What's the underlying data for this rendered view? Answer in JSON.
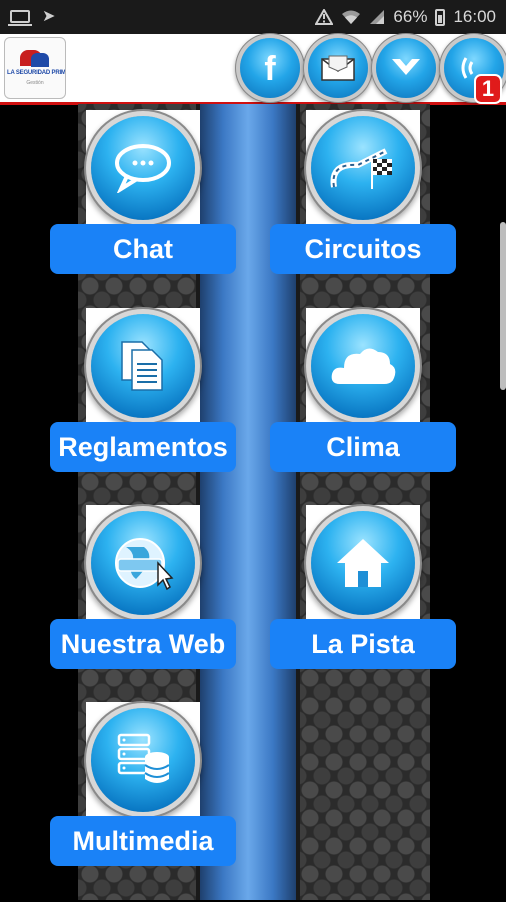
{
  "status_bar": {
    "battery": "66%",
    "time": "16:00",
    "icons": [
      "screen-icon",
      "send-icon",
      "alert-icon",
      "wifi-icon",
      "signal-icon",
      "battery-icon"
    ]
  },
  "header": {
    "logo_text": "LA SEGURIDAD PRIMERO",
    "logo_sub": "Gestión",
    "buttons": [
      "facebook-icon",
      "mail-icon",
      "heart-icon",
      "notification-icon"
    ],
    "notification_count": "1"
  },
  "menu": {
    "items": [
      {
        "label": "Chat",
        "icon": "chat-icon"
      },
      {
        "label": "Circuitos",
        "icon": "race-track-icon"
      },
      {
        "label": "Reglamentos",
        "icon": "documents-icon"
      },
      {
        "label": "Clima",
        "icon": "cloud-icon"
      },
      {
        "label": "Nuestra Web",
        "icon": "globe-icon"
      },
      {
        "label": "La Pista",
        "icon": "home-icon"
      },
      {
        "label": "Multimedia",
        "icon": "database-icon"
      }
    ]
  },
  "colors": {
    "accent_blue": "#1a82f7",
    "header_border": "#d01010",
    "badge": "#e01b1b"
  }
}
